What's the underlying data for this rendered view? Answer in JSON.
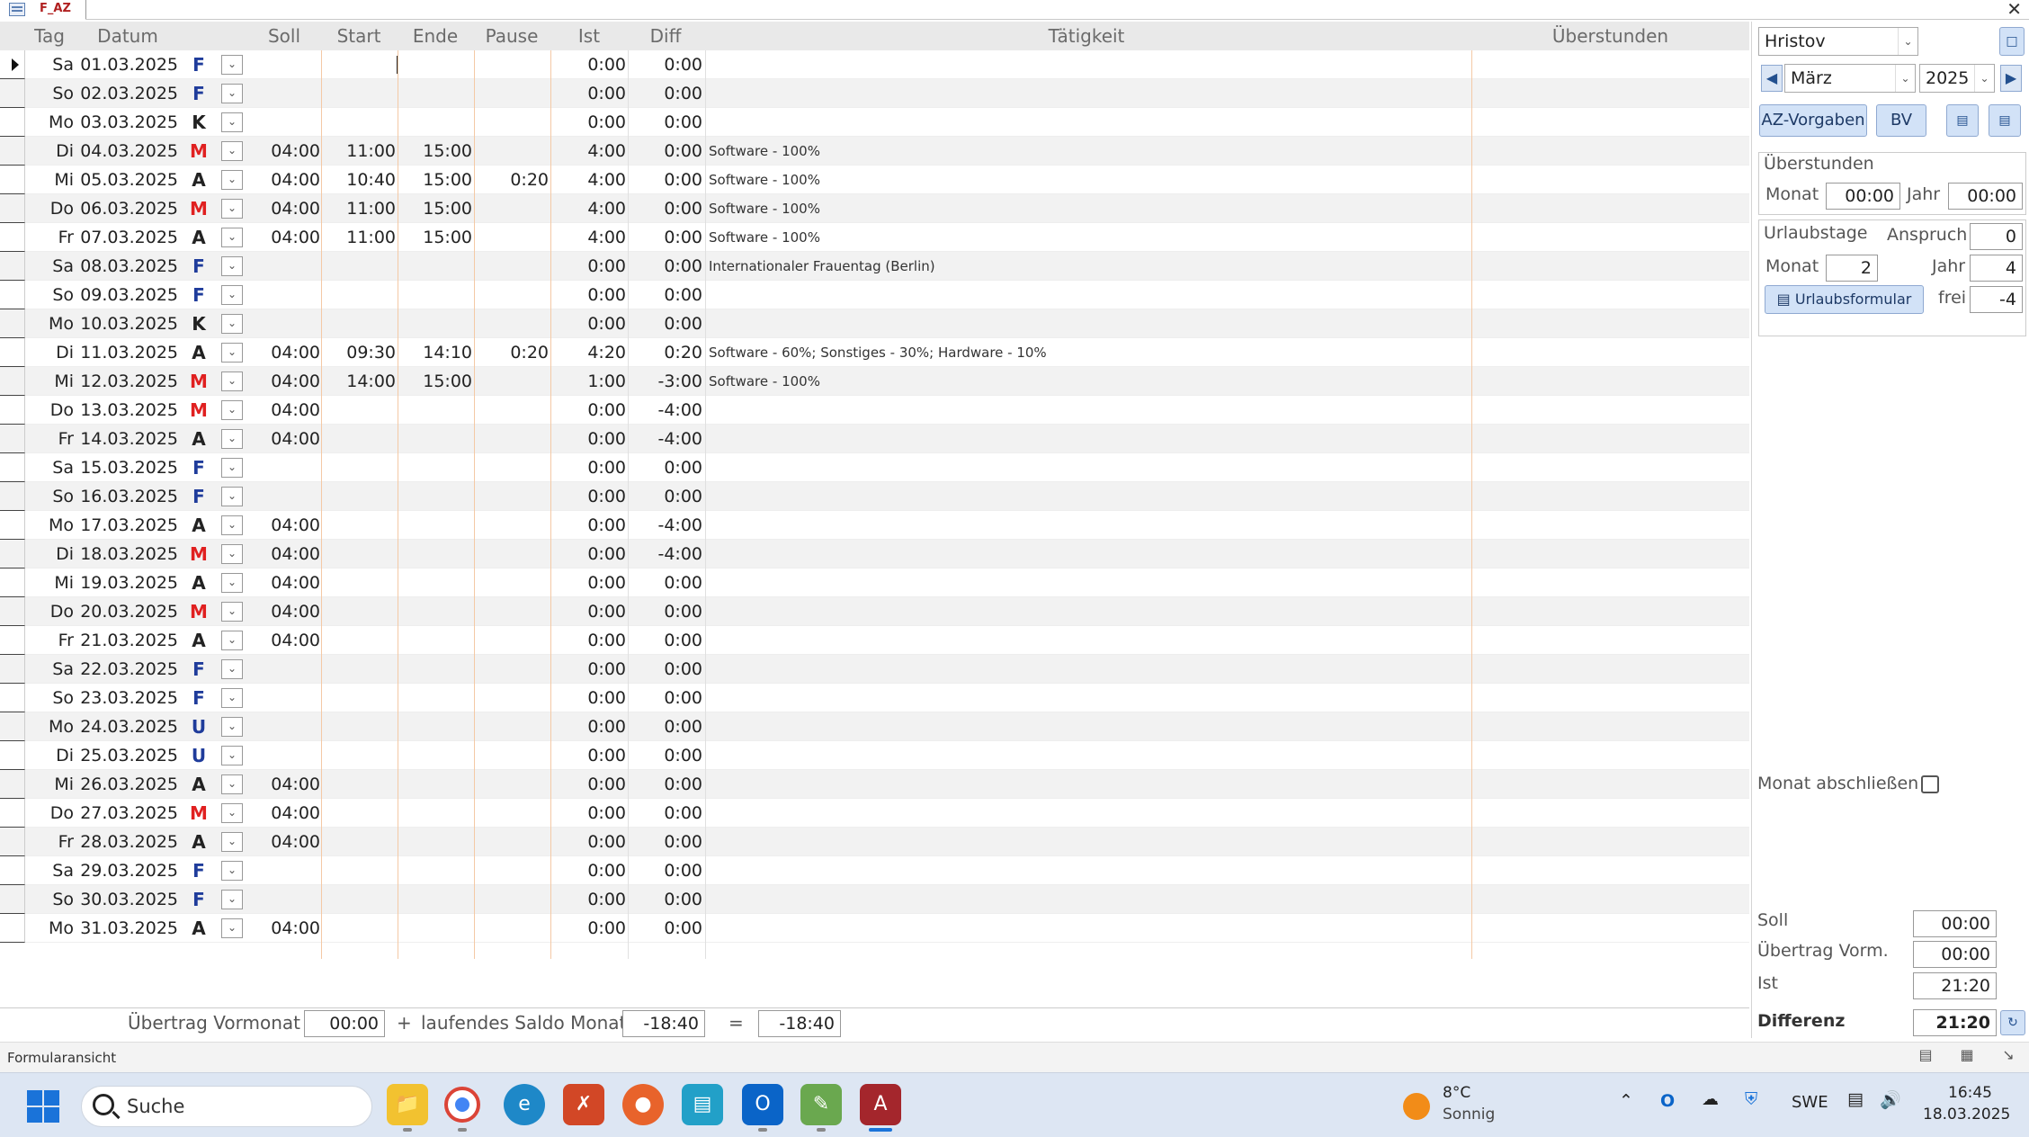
{
  "window": {
    "tab_title": "F_AZ",
    "close_glyph": "✕"
  },
  "grid": {
    "headers": {
      "tag": "Tag",
      "datum": "Datum",
      "soll": "Soll",
      "start": "Start",
      "ende": "Ende",
      "pause": "Pause",
      "ist": "Ist",
      "diff": "Diff",
      "taetigkeit": "Tätigkeit",
      "ueberstunden": "Überstunden"
    },
    "rows": [
      {
        "tag": "Sa",
        "datum": "01.03.2025",
        "code": "F",
        "soll": "",
        "start": "",
        "ende": "",
        "pause": "",
        "ist": "0:00",
        "diff": "0:00",
        "taet": ""
      },
      {
        "tag": "So",
        "datum": "02.03.2025",
        "code": "F",
        "soll": "",
        "start": "",
        "ende": "",
        "pause": "",
        "ist": "0:00",
        "diff": "0:00",
        "taet": ""
      },
      {
        "tag": "Mo",
        "datum": "03.03.2025",
        "code": "K",
        "soll": "",
        "start": "",
        "ende": "",
        "pause": "",
        "ist": "0:00",
        "diff": "0:00",
        "taet": ""
      },
      {
        "tag": "Di",
        "datum": "04.03.2025",
        "code": "M",
        "soll": "04:00",
        "start": "11:00",
        "ende": "15:00",
        "pause": "",
        "ist": "4:00",
        "diff": "0:00",
        "taet": "Software - 100%"
      },
      {
        "tag": "Mi",
        "datum": "05.03.2025",
        "code": "A",
        "soll": "04:00",
        "start": "10:40",
        "ende": "15:00",
        "pause": "0:20",
        "ist": "4:00",
        "diff": "0:00",
        "taet": "Software - 100%"
      },
      {
        "tag": "Do",
        "datum": "06.03.2025",
        "code": "M",
        "soll": "04:00",
        "start": "11:00",
        "ende": "15:00",
        "pause": "",
        "ist": "4:00",
        "diff": "0:00",
        "taet": "Software - 100%"
      },
      {
        "tag": "Fr",
        "datum": "07.03.2025",
        "code": "A",
        "soll": "04:00",
        "start": "11:00",
        "ende": "15:00",
        "pause": "",
        "ist": "4:00",
        "diff": "0:00",
        "taet": "Software - 100%"
      },
      {
        "tag": "Sa",
        "datum": "08.03.2025",
        "code": "F",
        "soll": "",
        "start": "",
        "ende": "",
        "pause": "",
        "ist": "0:00",
        "diff": "0:00",
        "taet": "Internationaler Frauentag (Berlin)"
      },
      {
        "tag": "So",
        "datum": "09.03.2025",
        "code": "F",
        "soll": "",
        "start": "",
        "ende": "",
        "pause": "",
        "ist": "0:00",
        "diff": "0:00",
        "taet": ""
      },
      {
        "tag": "Mo",
        "datum": "10.03.2025",
        "code": "K",
        "soll": "",
        "start": "",
        "ende": "",
        "pause": "",
        "ist": "0:00",
        "diff": "0:00",
        "taet": ""
      },
      {
        "tag": "Di",
        "datum": "11.03.2025",
        "code": "A",
        "soll": "04:00",
        "start": "09:30",
        "ende": "14:10",
        "pause": "0:20",
        "ist": "4:20",
        "diff": "0:20",
        "taet": "Software - 60%; Sonstiges - 30%; Hardware - 10%"
      },
      {
        "tag": "Mi",
        "datum": "12.03.2025",
        "code": "M",
        "soll": "04:00",
        "start": "14:00",
        "ende": "15:00",
        "pause": "",
        "ist": "1:00",
        "diff": "-3:00",
        "taet": "Software - 100%"
      },
      {
        "tag": "Do",
        "datum": "13.03.2025",
        "code": "M",
        "soll": "04:00",
        "start": "",
        "ende": "",
        "pause": "",
        "ist": "0:00",
        "diff": "-4:00",
        "taet": ""
      },
      {
        "tag": "Fr",
        "datum": "14.03.2025",
        "code": "A",
        "soll": "04:00",
        "start": "",
        "ende": "",
        "pause": "",
        "ist": "0:00",
        "diff": "-4:00",
        "taet": ""
      },
      {
        "tag": "Sa",
        "datum": "15.03.2025",
        "code": "F",
        "soll": "",
        "start": "",
        "ende": "",
        "pause": "",
        "ist": "0:00",
        "diff": "0:00",
        "taet": ""
      },
      {
        "tag": "So",
        "datum": "16.03.2025",
        "code": "F",
        "soll": "",
        "start": "",
        "ende": "",
        "pause": "",
        "ist": "0:00",
        "diff": "0:00",
        "taet": ""
      },
      {
        "tag": "Mo",
        "datum": "17.03.2025",
        "code": "A",
        "soll": "04:00",
        "start": "",
        "ende": "",
        "pause": "",
        "ist": "0:00",
        "diff": "-4:00",
        "taet": ""
      },
      {
        "tag": "Di",
        "datum": "18.03.2025",
        "code": "M",
        "soll": "04:00",
        "start": "",
        "ende": "",
        "pause": "",
        "ist": "0:00",
        "diff": "-4:00",
        "taet": ""
      },
      {
        "tag": "Mi",
        "datum": "19.03.2025",
        "code": "A",
        "soll": "04:00",
        "start": "",
        "ende": "",
        "pause": "",
        "ist": "0:00",
        "diff": "0:00",
        "taet": ""
      },
      {
        "tag": "Do",
        "datum": "20.03.2025",
        "code": "M",
        "soll": "04:00",
        "start": "",
        "ende": "",
        "pause": "",
        "ist": "0:00",
        "diff": "0:00",
        "taet": ""
      },
      {
        "tag": "Fr",
        "datum": "21.03.2025",
        "code": "A",
        "soll": "04:00",
        "start": "",
        "ende": "",
        "pause": "",
        "ist": "0:00",
        "diff": "0:00",
        "taet": ""
      },
      {
        "tag": "Sa",
        "datum": "22.03.2025",
        "code": "F",
        "soll": "",
        "start": "",
        "ende": "",
        "pause": "",
        "ist": "0:00",
        "diff": "0:00",
        "taet": ""
      },
      {
        "tag": "So",
        "datum": "23.03.2025",
        "code": "F",
        "soll": "",
        "start": "",
        "ende": "",
        "pause": "",
        "ist": "0:00",
        "diff": "0:00",
        "taet": ""
      },
      {
        "tag": "Mo",
        "datum": "24.03.2025",
        "code": "U",
        "soll": "",
        "start": "",
        "ende": "",
        "pause": "",
        "ist": "0:00",
        "diff": "0:00",
        "taet": ""
      },
      {
        "tag": "Di",
        "datum": "25.03.2025",
        "code": "U",
        "soll": "",
        "start": "",
        "ende": "",
        "pause": "",
        "ist": "0:00",
        "diff": "0:00",
        "taet": ""
      },
      {
        "tag": "Mi",
        "datum": "26.03.2025",
        "code": "A",
        "soll": "04:00",
        "start": "",
        "ende": "",
        "pause": "",
        "ist": "0:00",
        "diff": "0:00",
        "taet": ""
      },
      {
        "tag": "Do",
        "datum": "27.03.2025",
        "code": "M",
        "soll": "04:00",
        "start": "",
        "ende": "",
        "pause": "",
        "ist": "0:00",
        "diff": "0:00",
        "taet": ""
      },
      {
        "tag": "Fr",
        "datum": "28.03.2025",
        "code": "A",
        "soll": "04:00",
        "start": "",
        "ende": "",
        "pause": "",
        "ist": "0:00",
        "diff": "0:00",
        "taet": ""
      },
      {
        "tag": "Sa",
        "datum": "29.03.2025",
        "code": "F",
        "soll": "",
        "start": "",
        "ende": "",
        "pause": "",
        "ist": "0:00",
        "diff": "0:00",
        "taet": ""
      },
      {
        "tag": "So",
        "datum": "30.03.2025",
        "code": "F",
        "soll": "",
        "start": "",
        "ende": "",
        "pause": "",
        "ist": "0:00",
        "diff": "0:00",
        "taet": ""
      },
      {
        "tag": "Mo",
        "datum": "31.03.2025",
        "code": "A",
        "soll": "04:00",
        "start": "",
        "ende": "",
        "pause": "",
        "ist": "0:00",
        "diff": "0:00",
        "taet": ""
      }
    ],
    "code_colors": {
      "F": "#1f3c9b",
      "K": "#222222",
      "M": "#e02020",
      "A": "#222222",
      "U": "#1f3c9b"
    }
  },
  "footer": {
    "uebertrag_label": "Übertrag Vormonat",
    "uebertrag_value": "00:00",
    "plus": "+",
    "saldo_label": "laufendes Saldo Monat",
    "saldo_value": "-18:40",
    "eq": "=",
    "result_value": "-18:40"
  },
  "panel": {
    "employee": "Hristov",
    "month": "März",
    "year": "2025",
    "btn_az": "AZ-Vorgaben",
    "btn_bv": "BV",
    "ueberstunden_title": "Überstunden",
    "ue_monat_label": "Monat",
    "ue_monat_value": "00:00",
    "ue_jahr_label": "Jahr",
    "ue_jahr_value": "00:00",
    "urlaub_title": "Urlaubstage",
    "anspruch_label": "Anspruch",
    "anspruch_value": "0",
    "u_monat_label": "Monat",
    "u_monat_value": "2",
    "u_jahr_label": "Jahr",
    "u_jahr_value": "4",
    "urlaubsformular": "Urlaubsformular",
    "frei_label": "frei",
    "frei_value": "-4",
    "abschliessen": "Monat abschließen",
    "soll_label": "Soll",
    "soll_value": "00:00",
    "uebertrag_label": "Übertrag Vorm.",
    "uebertrag_value": "00:00",
    "ist_label": "Ist",
    "ist_value": "21:20",
    "differenz_label": "Differenz",
    "differenz_value": "21:20"
  },
  "statusbar": {
    "text": "Formularansicht"
  },
  "taskbar": {
    "search": "Suche",
    "weather_temp": "8°C",
    "weather_text": "Sonnig",
    "lang": "SWE",
    "time": "16:45",
    "date": "18.03.2025"
  }
}
